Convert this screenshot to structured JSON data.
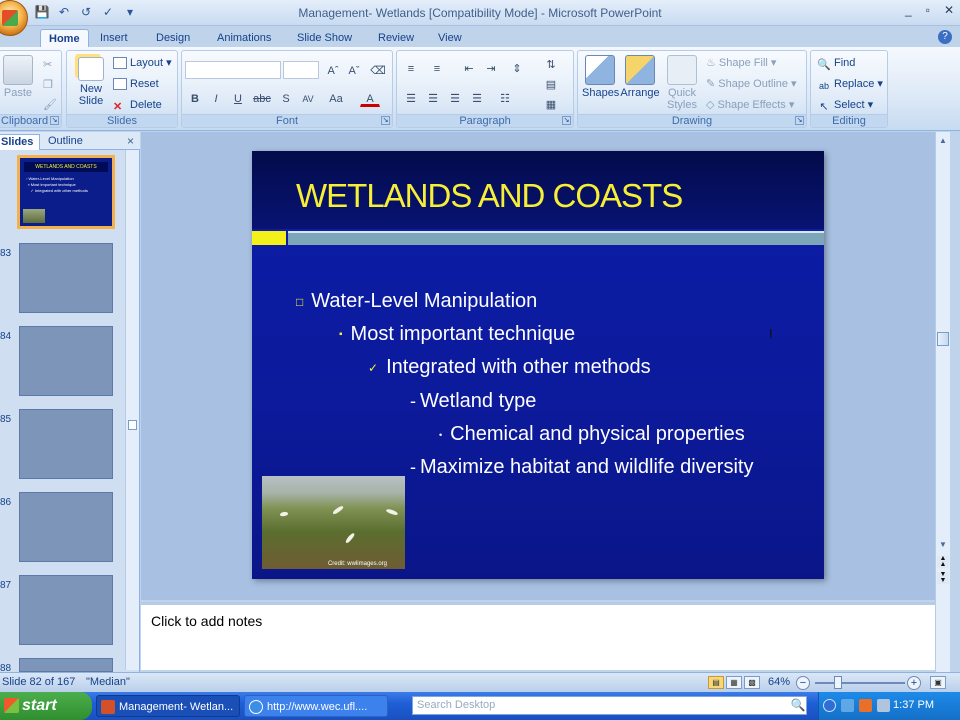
{
  "window": {
    "title": "Management- Wetlands [Compatibility Mode] - Microsoft PowerPoint",
    "controls": [
      "_",
      "▫",
      "✕"
    ]
  },
  "ribbon_tabs": [
    "Home",
    "Insert",
    "Design",
    "Animations",
    "Slide Show",
    "Review",
    "View"
  ],
  "ribbon": {
    "clipboard": {
      "paste": "Paste",
      "label": "Clipboard"
    },
    "slides": {
      "new_slide": "New Slide",
      "layout": "Layout",
      "reset": "Reset",
      "delete": "Delete",
      "label": "Slides"
    },
    "font": {
      "label": "Font",
      "bold": "B",
      "italic": "I",
      "underline": "U",
      "strike": "abc",
      "shadow": "S",
      "spacing": "AV",
      "case": "Aa",
      "color": "A"
    },
    "paragraph": {
      "label": "Paragraph"
    },
    "drawing": {
      "shapes": "Shapes",
      "arrange": "Arrange",
      "quick_styles": "Quick Styles",
      "shape_fill": "Shape Fill",
      "shape_outline": "Shape Outline",
      "shape_effects": "Shape Effects",
      "label": "Drawing"
    },
    "editing": {
      "find": "Find",
      "replace": "Replace",
      "select": "Select",
      "label": "Editing"
    }
  },
  "left_pane": {
    "tabs": [
      "Slides",
      "Outline"
    ],
    "close": "×",
    "thumbs": [
      {
        "num": "",
        "active": true
      },
      {
        "num": "83"
      },
      {
        "num": "84"
      },
      {
        "num": "85"
      },
      {
        "num": "86"
      },
      {
        "num": "87"
      },
      {
        "num": "88"
      }
    ]
  },
  "slide": {
    "title": "WETLANDS AND COASTS",
    "bullets": [
      {
        "level": 1,
        "marker": "□",
        "text": "Water-Level Manipulation"
      },
      {
        "level": 2,
        "marker": "▪",
        "text": "Most important technique"
      },
      {
        "level": 3,
        "marker": "✓",
        "text": "Integrated with other methods"
      },
      {
        "level": 4,
        "marker": "-",
        "text": "Wetland type"
      },
      {
        "level": 5,
        "marker": "•",
        "text": "Chemical and physical properties"
      },
      {
        "level": 4,
        "marker": "-",
        "text": "Maximize habitat and wildlife diversity"
      }
    ],
    "photo_credit": "Credit: wwlimages.org"
  },
  "notes": {
    "placeholder": "Click to add notes"
  },
  "status": {
    "slide": "Slide 82 of 167",
    "theme": "\"Median\"",
    "zoom": "64%"
  },
  "taskbar": {
    "start": "start",
    "tasks": [
      "Management- Wetlan...",
      "http://www.wec.ufl...."
    ],
    "search_placeholder": "Search Desktop",
    "clock": "1:37 PM"
  }
}
